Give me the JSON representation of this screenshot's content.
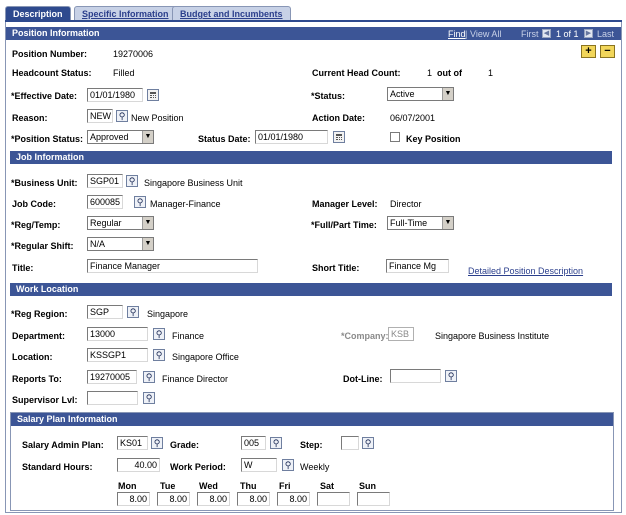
{
  "tabs": [
    {
      "label": "Description",
      "active": true
    },
    {
      "label": "Specific Information",
      "active": false
    },
    {
      "label": "Budget and Incumbents",
      "active": false
    }
  ],
  "position_info": {
    "header": "Position Information",
    "nav": {
      "find": "Find",
      "view_all": "View All",
      "first": "First",
      "count": "1 of 1",
      "last": "Last"
    },
    "position_number_label": "Position Number:",
    "position_number": "19270006",
    "headcount_status_label": "Headcount Status:",
    "headcount_status": "Filled",
    "current_head_count_label": "Current Head Count:",
    "current_head_count": "1",
    "out_of_label": "out of",
    "out_of_value": "1",
    "effective_date_label": "*Effective Date:",
    "effective_date": "01/01/1980",
    "status_label": "*Status:",
    "status": "Active",
    "reason_label": "Reason:",
    "reason_code": "NEW",
    "reason_desc": "New Position",
    "action_date_label": "Action Date:",
    "action_date": "06/07/2001",
    "position_status_label": "*Position Status:",
    "position_status": "Approved",
    "status_date_label": "Status Date:",
    "status_date": "01/01/1980",
    "key_position_label": "Key Position",
    "key_position_checked": false
  },
  "job_info": {
    "header": "Job Information",
    "business_unit_label": "*Business Unit:",
    "business_unit": "SGP01",
    "business_unit_desc": "Singapore Business Unit",
    "job_code_label": "Job Code:",
    "job_code": "600085",
    "job_code_desc": "Manager-Finance",
    "manager_level_label": "Manager Level:",
    "manager_level": "Director",
    "reg_temp_label": "*Reg/Temp:",
    "reg_temp": "Regular",
    "full_part_time_label": "*Full/Part Time:",
    "full_part_time": "Full-Time",
    "regular_shift_label": "*Regular Shift:",
    "regular_shift": "N/A",
    "title_label": "Title:",
    "title": "Finance Manager",
    "short_title_label": "Short Title:",
    "short_title": "Finance Mg",
    "detailed_link": "Detailed Position Description"
  },
  "work_location": {
    "header": "Work Location",
    "reg_region_label": "*Reg Region:",
    "reg_region": "SGP",
    "reg_region_desc": "Singapore",
    "department_label": "Department:",
    "department": "13000",
    "department_desc": "Finance",
    "company_label": "*Company:",
    "company": "KSB",
    "company_desc": "Singapore Business Institute",
    "location_label": "Location:",
    "location": "KSSGP1",
    "location_desc": "Singapore Office",
    "reports_to_label": "Reports To:",
    "reports_to": "19270005",
    "reports_to_desc": "Finance Director",
    "dot_line_label": "Dot-Line:",
    "dot_line": "",
    "supervisor_lvl_label": "Supervisor Lvl:",
    "supervisor_lvl": ""
  },
  "salary_plan": {
    "header": "Salary Plan Information",
    "salary_admin_plan_label": "Salary Admin Plan:",
    "salary_admin_plan": "KS01",
    "grade_label": "Grade:",
    "grade": "005",
    "step_label": "Step:",
    "step": "",
    "standard_hours_label": "Standard Hours:",
    "standard_hours": "40.00",
    "work_period_label": "Work Period:",
    "work_period": "W",
    "work_period_desc": "Weekly",
    "days": [
      {
        "label": "Mon",
        "value": "8.00"
      },
      {
        "label": "Tue",
        "value": "8.00"
      },
      {
        "label": "Wed",
        "value": "8.00"
      },
      {
        "label": "Thu",
        "value": "8.00"
      },
      {
        "label": "Fri",
        "value": "8.00"
      },
      {
        "label": "Sat",
        "value": ""
      },
      {
        "label": "Sun",
        "value": ""
      }
    ]
  },
  "icons": {
    "lookup": "magnifier-icon",
    "calendar": "calendar-icon",
    "dropdown": "chevron-down-icon",
    "add": "plus",
    "delete": "minus"
  },
  "colors": {
    "header_bg": "#3c5596",
    "tab_active": "#2e4a8e",
    "tab_inactive": "#c7d1e6",
    "link": "#2b3f8c",
    "button_yellow": "#f2d65a"
  }
}
